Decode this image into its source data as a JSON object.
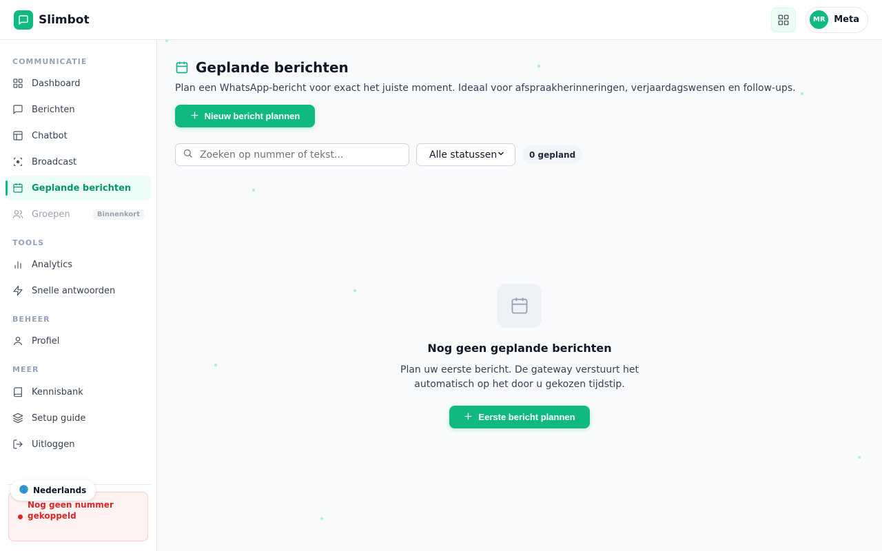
{
  "app": {
    "name": "Slimbot"
  },
  "header": {
    "user_initials": "MR",
    "user_name": "Meta"
  },
  "sidebar": {
    "sections": [
      {
        "title": "COMMUNICATIE"
      },
      {
        "title": "TOOLS"
      },
      {
        "title": "BEHEER"
      },
      {
        "title": "MEER"
      }
    ],
    "items": [
      {
        "label": "Dashboard",
        "icon": "dashboard-icon"
      },
      {
        "label": "Berichten",
        "icon": "message-icon"
      },
      {
        "label": "Chatbot",
        "icon": "layout-icon"
      },
      {
        "label": "Broadcast",
        "icon": "broadcast-icon"
      },
      {
        "label": "Geplande berichten",
        "icon": "calendar-icon",
        "active": true
      },
      {
        "label": "Groepen",
        "icon": "users-icon",
        "badge": "Binnenkort",
        "disabled": true
      },
      {
        "label": "Analytics",
        "icon": "bar-chart-icon"
      },
      {
        "label": "Snelle antwoorden",
        "icon": "lightning-icon"
      },
      {
        "label": "Profiel",
        "icon": "user-icon"
      },
      {
        "label": "Kennisbank",
        "icon": "book-icon"
      },
      {
        "label": "Setup guide",
        "icon": "layers-icon"
      },
      {
        "label": "Uitloggen",
        "icon": "logout-icon"
      }
    ],
    "warning": "Nog geen nummer gekoppeld",
    "language": "Nederlands"
  },
  "main": {
    "title": "Geplande berichten",
    "subtitle": "Plan een WhatsApp-bericht voor exact het juiste moment. Ideaal voor afspraakherinneringen, verjaardagswensen en follow-ups.",
    "new_button": "Nieuw bericht plannen",
    "search_placeholder": "Zoeken op nummer of tekst...",
    "status_filter": "Alle statussen",
    "count_badge": "0 gepland",
    "empty": {
      "title": "Nog geen geplande berichten",
      "description": "Plan uw eerste bericht. De gateway verstuurt het automatisch op het door u gekozen tijdstip.",
      "button": "Eerste bericht plannen"
    }
  },
  "colors": {
    "accent": "#10b981",
    "accent_dark": "#059669",
    "danger": "#dc2626"
  }
}
